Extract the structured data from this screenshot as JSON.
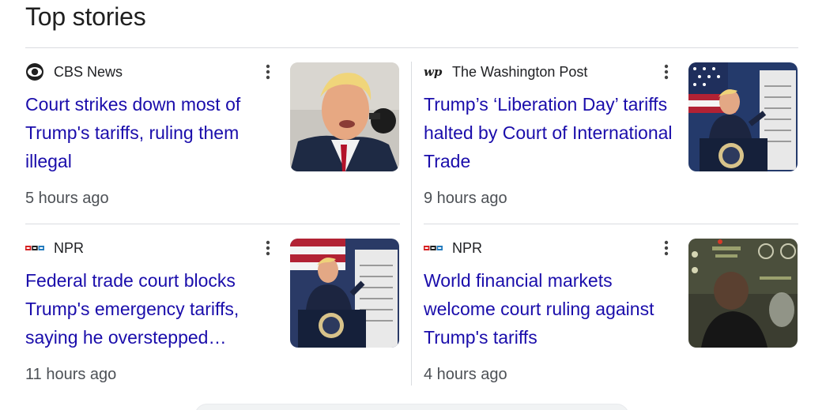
{
  "section": {
    "title": "Top stories"
  },
  "stories": [
    {
      "source": "CBS News",
      "logo_icon": "cbs-eye-icon",
      "title": "Court strikes down most of Trump's tariffs, ruling them illegal",
      "time": "5 hours ago"
    },
    {
      "source": "The Washington Post",
      "logo_icon": "wp-logo-icon",
      "title": "Trump’s ‘Liberation Day’ tariffs halted by Court of International Trade",
      "time": "9 hours ago"
    },
    {
      "source": "NPR",
      "logo_icon": "npr-logo-icon",
      "title": "Federal trade court blocks Trump's emergency tariffs, saying he overstepped…",
      "time": "11 hours ago"
    },
    {
      "source": "NPR",
      "logo_icon": "npr-logo-icon",
      "title": "World financial markets welcome court ruling against Trump's tariffs",
      "time": "4 hours ago"
    }
  ],
  "colors": {
    "link": "#1a0dab",
    "meta": "#4d5156",
    "divider": "#dadce0",
    "npr_red": "#d62021",
    "npr_blue": "#237bbd"
  }
}
